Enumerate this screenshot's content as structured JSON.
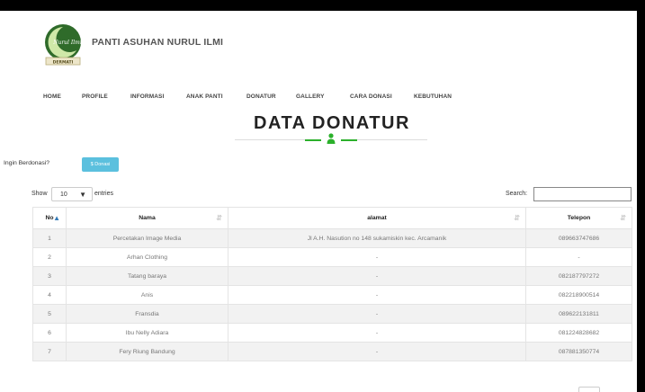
{
  "site": {
    "title": "PANTI ASUHAN NURUL ILMI",
    "logo_text": "Nurul Ilmi",
    "logo_subtext": "DERMATI"
  },
  "nav": [
    "HOME",
    "PROFILE",
    "INFORMASI",
    "ANAK PANTI",
    "DONATUR",
    "GALLERY",
    "CARA DONASI",
    "KEBUTUHAN"
  ],
  "page": {
    "title": "DATA DONATUR"
  },
  "donate": {
    "prompt": "Ingin Berdonasi?",
    "button": "$ Donasi"
  },
  "table_controls": {
    "show": "Show",
    "length": "10",
    "entries": "entries",
    "search": "Search:"
  },
  "table": {
    "columns": [
      "No",
      "Nama",
      "alamat",
      "Telepon"
    ],
    "rows": [
      [
        "1",
        "Percetakan Image Media",
        "Jl A.H. Nasution no 148 sukamiskin kec. Arcamanik",
        "089663747686"
      ],
      [
        "2",
        "Arhan Clothing",
        "-",
        "-"
      ],
      [
        "3",
        "Tatang baraya",
        "-",
        "082187797272"
      ],
      [
        "4",
        "Anis",
        "-",
        "082218900514"
      ],
      [
        "5",
        "Fransdia",
        "-",
        "089622131811"
      ],
      [
        "6",
        "Ibu Nelly Adiara",
        "-",
        "081224828682"
      ],
      [
        "7",
        "Fery Riung Bandung",
        "-",
        "087881350774"
      ]
    ]
  },
  "colors": {
    "accent_green": "#2bb02b",
    "donate_button": "#5bc0de"
  },
  "icons": {
    "logo": "logo-emblem",
    "divider": "user-icon",
    "select": "chevron-down-icon",
    "sort": "sort-icon"
  }
}
